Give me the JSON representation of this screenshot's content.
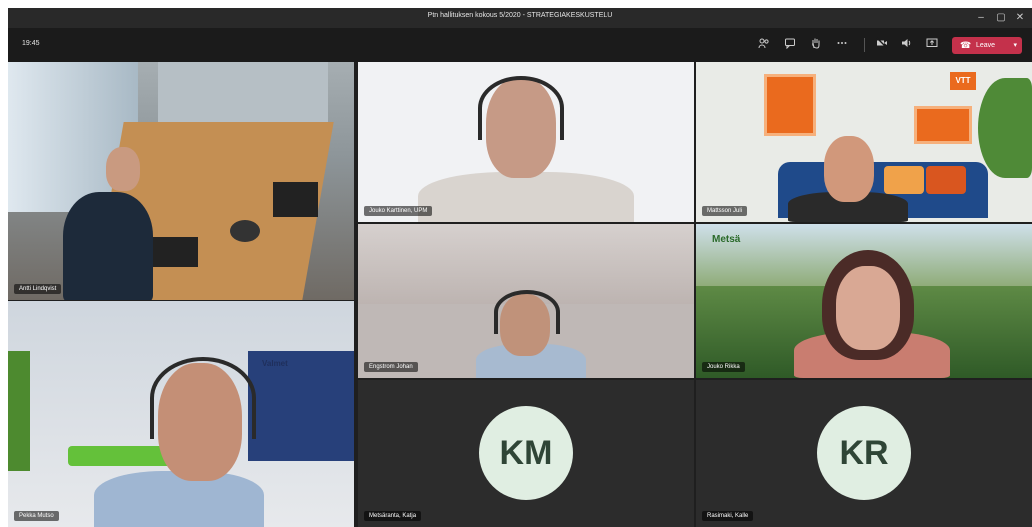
{
  "window": {
    "title": "Ptn hallituksen kokous 5/2020 - STRATEGIAKESKUSTELU"
  },
  "window_controls": {
    "minimize": "–",
    "maximize": "▢",
    "close": "✕"
  },
  "toolbar": {
    "timer": "19:45",
    "leave_label": "Leave",
    "icons": [
      "people-icon",
      "chat-icon",
      "raise-hand-icon",
      "more-icon",
      "camera-icon",
      "mic-icon",
      "share-icon"
    ]
  },
  "participants": [
    {
      "name": "Antti Lindqvist"
    },
    {
      "name": "Jouko Karttinen, UPM"
    },
    {
      "name": "Mattsson Juli"
    },
    {
      "name": "Pekka Mutso"
    },
    {
      "name": "Engstrom Johan"
    },
    {
      "name": "Jouko Rikka"
    },
    {
      "name": "Metsäranta, Katja",
      "initials": "KM"
    },
    {
      "name": "Rasimaki, Kalle",
      "initials": "KR"
    }
  ],
  "backgrounds": {
    "metsa_logo": "Metsä",
    "valmet_logo": "Valmet",
    "vtt_logo": "VTT"
  },
  "colors": {
    "leave": "#c4314b",
    "avatar_bg": "#e0eee2",
    "avatar_text": "#2f4536"
  }
}
